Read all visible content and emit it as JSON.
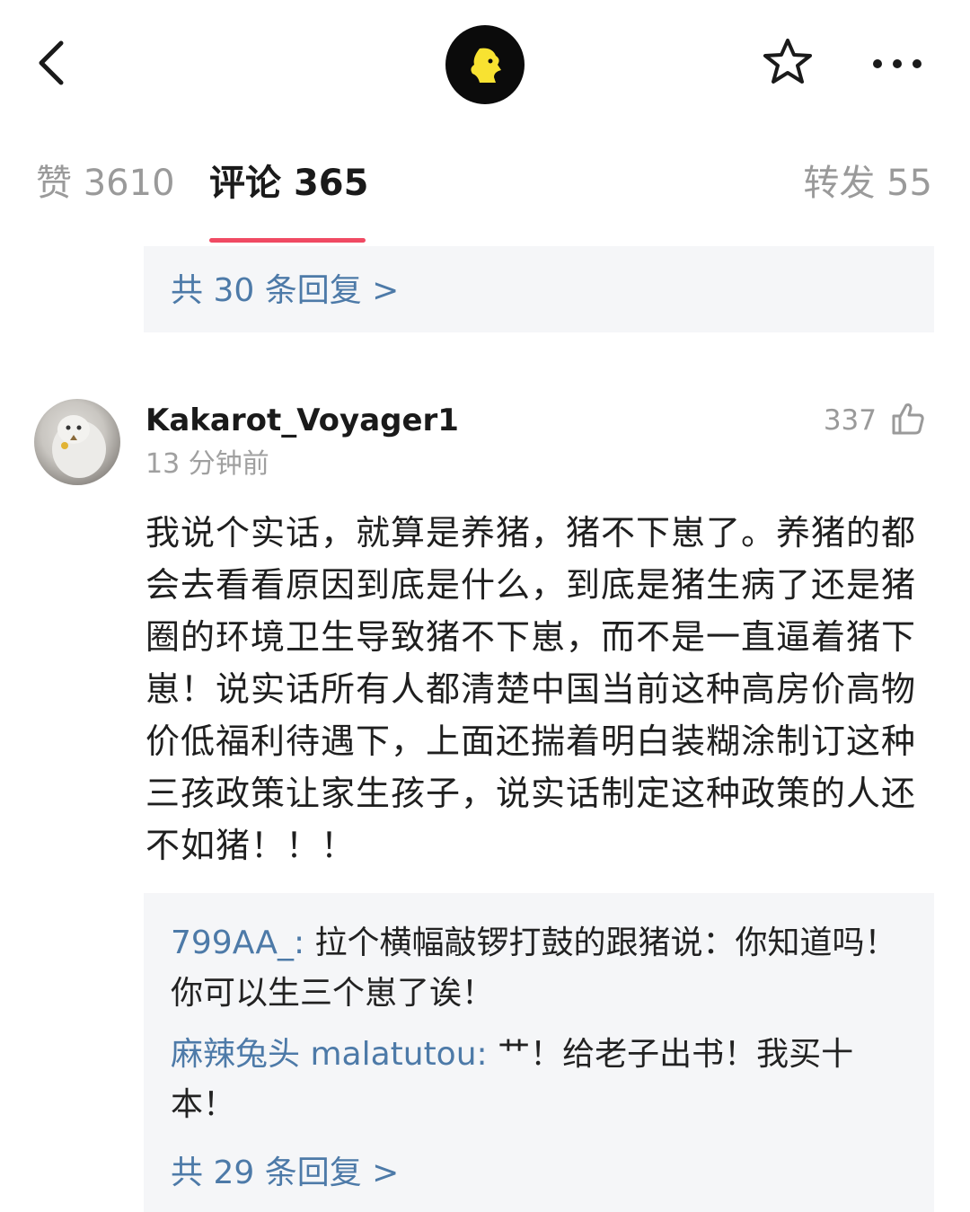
{
  "nav": {
    "back_icon": "chevron-left-icon",
    "logo_icon": "app-logo",
    "favorite_icon": "star-icon",
    "more_icon": "more-horizontal-icon"
  },
  "tabs": [
    {
      "label": "赞",
      "count": "3610",
      "active": false
    },
    {
      "label": "评论",
      "count": "365",
      "active": true
    },
    {
      "label": "转发",
      "count": "55",
      "active": false
    }
  ],
  "accent_color": "#f04a63",
  "link_color": "#4d7aa8",
  "previous_thread": {
    "more_replies": "共 30 条回复 >"
  },
  "comment": {
    "username": "Kakarot_Voyager1",
    "time": "13 分钟前",
    "likes": "337",
    "text": "我说个实话，就算是养猪，猪不下崽了。养猪的都会去看看原因到底是什么，到底是猪生病了还是猪圈的环境卫生导致猪不下崽，而不是一直逼着猪下崽！说实话所有人都清楚中国当前这种高房价高物价低福利待遇下，上面还揣着明白装糊涂制订这种三孩政策让家生孩子，说实话制定这种政策的人还不如猪！！！",
    "replies": [
      {
        "user": "799AA_:",
        "text": " 拉个横幅敲锣打鼓的跟猪说：你知道吗！你可以生三个崽了诶！"
      },
      {
        "user": "麻辣兔头 malatutou:",
        "text": " 艹！给老子出书！我买十本！"
      }
    ],
    "more_replies": "共 29 条回复 >"
  }
}
